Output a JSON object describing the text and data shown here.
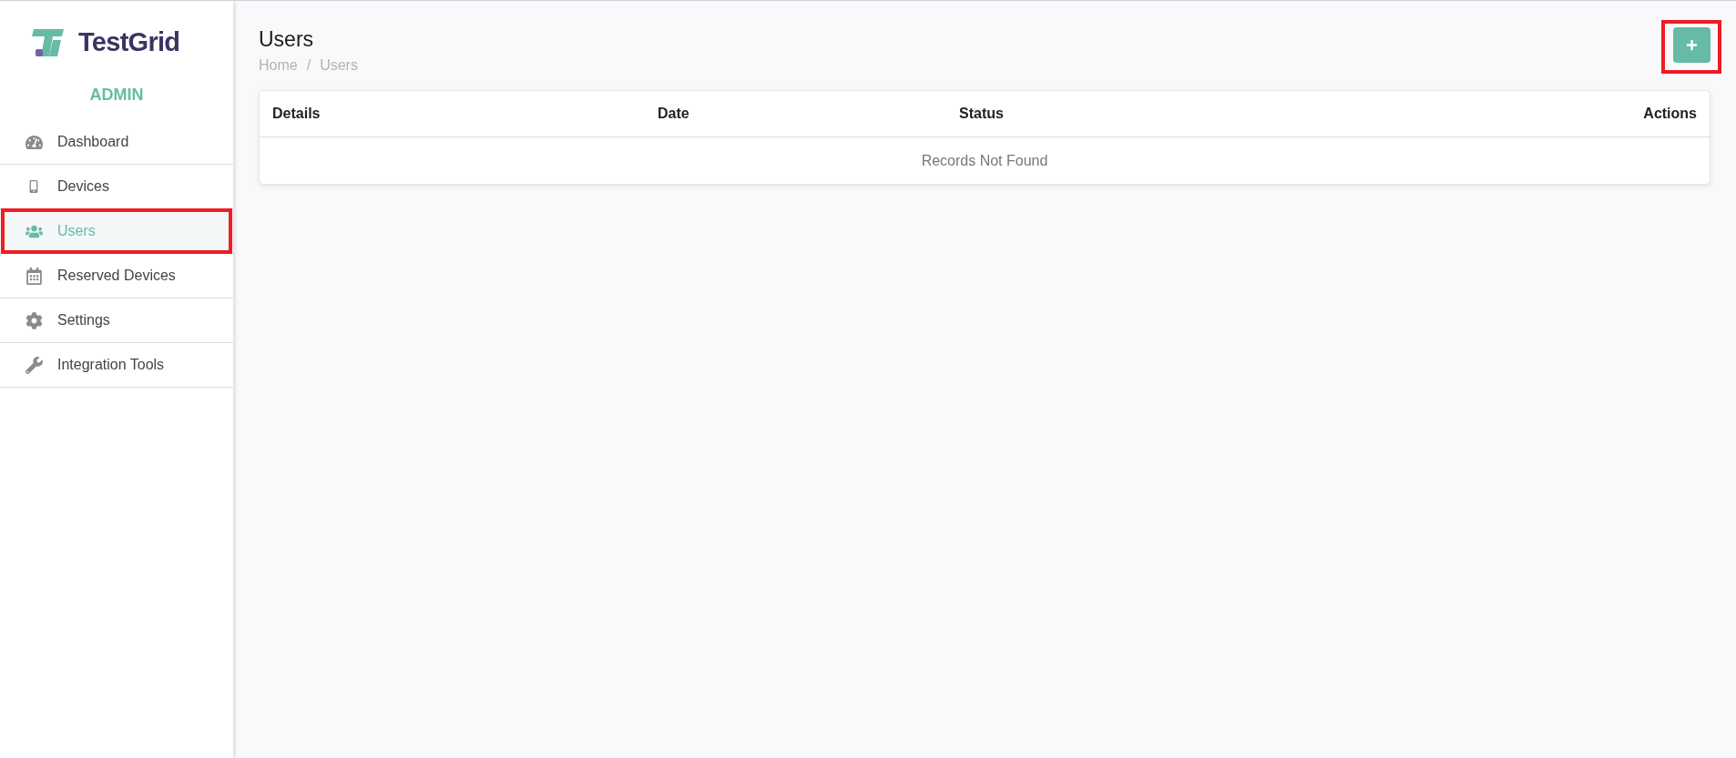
{
  "sidebar": {
    "brand": "TestGrid",
    "role": "ADMIN",
    "items": [
      {
        "label": "Dashboard",
        "selected": false,
        "highlighted": false
      },
      {
        "label": "Devices",
        "selected": false,
        "highlighted": false
      },
      {
        "label": "Users",
        "selected": true,
        "highlighted": true
      },
      {
        "label": "Reserved Devices",
        "selected": false,
        "highlighted": false
      },
      {
        "label": "Settings",
        "selected": false,
        "highlighted": false
      },
      {
        "label": "Integration Tools",
        "selected": false,
        "highlighted": false
      }
    ]
  },
  "header": {
    "title": "Users",
    "breadcrumb": [
      "Home",
      "Users"
    ],
    "breadcrumb_separator": "/",
    "add_button": {
      "highlighted": true
    }
  },
  "table": {
    "columns": [
      "Details",
      "Date",
      "Status",
      "Actions"
    ],
    "empty_message": "Records Not Found"
  }
}
